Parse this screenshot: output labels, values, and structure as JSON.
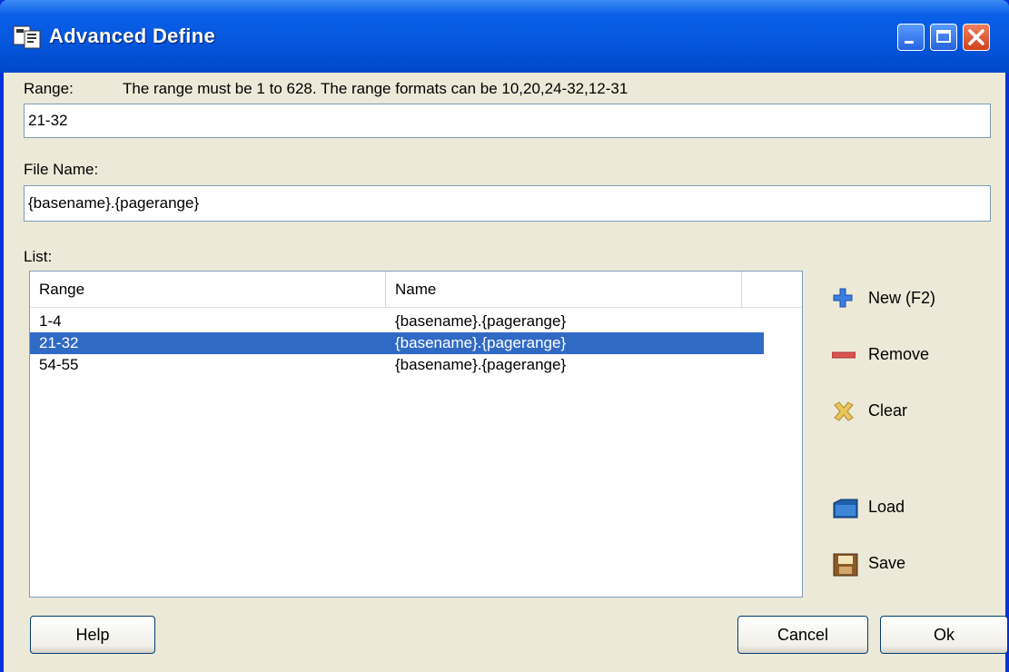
{
  "window": {
    "title": "Advanced Define"
  },
  "range": {
    "label": "Range:",
    "hint": "The range must be 1 to 628. The range formats can be 10,20,24-32,12-31",
    "value": "21-32"
  },
  "file_name": {
    "label": "File Name:",
    "value": "{basename}.{pagerange}"
  },
  "list": {
    "label": "List:",
    "columns": [
      "Range",
      "Name"
    ],
    "rows": [
      {
        "range": "1-4",
        "name": "{basename}.{pagerange}",
        "selected": false
      },
      {
        "range": "21-32",
        "name": "{basename}.{pagerange}",
        "selected": true
      },
      {
        "range": "54-55",
        "name": "{basename}.{pagerange}",
        "selected": false
      }
    ]
  },
  "side_buttons": {
    "new": "New (F2)",
    "remove": "Remove",
    "clear": "Clear",
    "load": "Load",
    "save": "Save"
  },
  "buttons": {
    "help": "Help",
    "cancel": "Cancel",
    "ok": "Ok"
  },
  "icons": [
    "app-icon",
    "minimize-icon",
    "maximize-icon",
    "close-icon",
    "plus-icon",
    "remove-bar-icon",
    "clear-x-icon",
    "folder-load-icon",
    "save-disk-icon"
  ],
  "colors": {
    "titlebar": "#0556dd",
    "selection": "#316ac5",
    "dialog_bg": "#ece9d8"
  }
}
